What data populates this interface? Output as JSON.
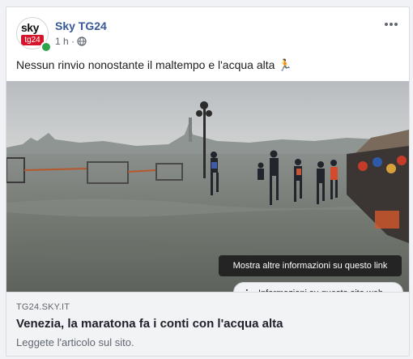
{
  "post": {
    "author": "Sky TG24",
    "time": "1 h ·",
    "text": "Nessun rinvio nonostante il maltempo e l'acqua alta 🏃",
    "avatar": {
      "line1": "sky",
      "line2": "tg24"
    }
  },
  "media": {
    "tooltip": "Mostra altre informazioni su questo link",
    "info_label": "Informazioni su questo sito web",
    "info_icon": "i"
  },
  "link": {
    "domain": "TG24.SKY.IT",
    "title": "Venezia, la maratona fa i conti con l'acqua alta",
    "description": "Leggete l'articolo sul sito."
  },
  "colors": {
    "author": "#385898",
    "online": "#31a24c",
    "brand_red": "#d6152b"
  },
  "icons": [
    "globe-icon",
    "more-options-icon",
    "info-icon",
    "online-status-icon"
  ]
}
